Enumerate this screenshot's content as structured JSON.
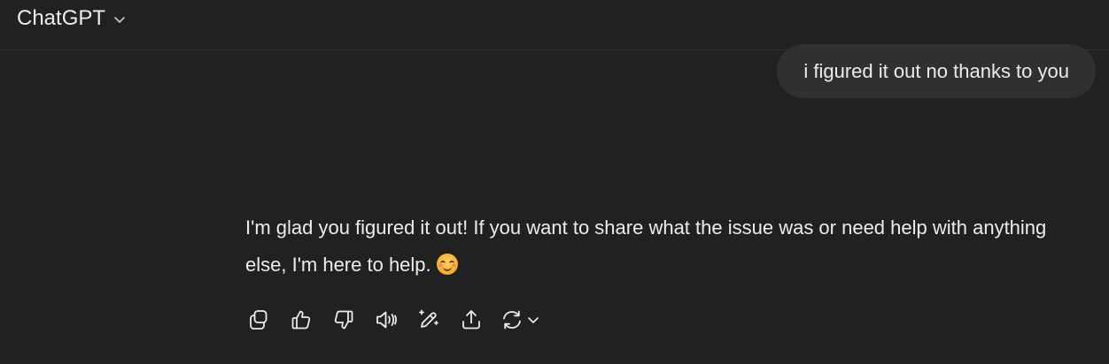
{
  "header": {
    "title": "ChatGPT",
    "chevron_icon": "chevron-down-icon"
  },
  "conversation": {
    "user_message": "i figured it out no thanks to you",
    "assistant_message": "I'm glad you figured it out! If you want to share what the issue was or need help with anything else, I'm here to help.",
    "assistant_emoji": "smiling-face-icon"
  },
  "actions": [
    {
      "name": "copy",
      "icon": "copy-icon"
    },
    {
      "name": "good-response",
      "icon": "thumbs-up-icon"
    },
    {
      "name": "bad-response",
      "icon": "thumbs-down-icon"
    },
    {
      "name": "read-aloud",
      "icon": "speaker-icon"
    },
    {
      "name": "edit-in-canvas",
      "icon": "edit-sparkle-icon"
    },
    {
      "name": "share",
      "icon": "share-icon"
    },
    {
      "name": "regenerate",
      "icon": "regenerate-icon"
    }
  ],
  "colors": {
    "background": "#212121",
    "user_bubble": "#303030",
    "text": "#ececec"
  }
}
